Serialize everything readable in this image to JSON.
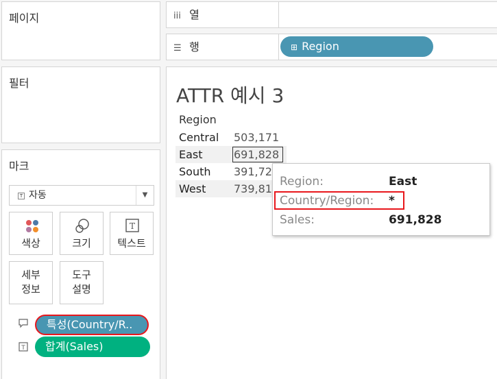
{
  "panels": {
    "pages": "페이지",
    "filters": "필터",
    "marks": "마크"
  },
  "shelves": {
    "columns": {
      "icon": "iii",
      "label": "열"
    },
    "rows": {
      "icon": "☰",
      "label": "행",
      "pill": "Region"
    }
  },
  "marks_card": {
    "type": "자동",
    "buttons": {
      "color": "색상",
      "size": "크기",
      "text": "텍스트",
      "detail_1": "세부",
      "detail_2": "정보",
      "tooltip_1": "도구",
      "tooltip_2": "설명"
    },
    "fields": [
      {
        "pill": "특성(Country/R..",
        "color": "#4996b2"
      },
      {
        "pill": "합계(Sales)",
        "color": "#00b180"
      }
    ]
  },
  "view": {
    "title": "ATTR 예시 3",
    "column_header": "Region",
    "rows": [
      {
        "region": "Central",
        "sales": "503,171"
      },
      {
        "region": "East",
        "sales": "691,828"
      },
      {
        "region": "South",
        "sales": "391,72"
      },
      {
        "region": "West",
        "sales": "739,81"
      }
    ]
  },
  "tooltip": {
    "region_key": "Region:",
    "region_val": "East",
    "country_key": "Country/Region:",
    "country_val": "*",
    "sales_key": "Sales:",
    "sales_val": "691,828"
  },
  "colors": {
    "dimension_pill": "#4996b2",
    "measure_pill": "#00b180",
    "highlight_box": "#e8161b"
  }
}
